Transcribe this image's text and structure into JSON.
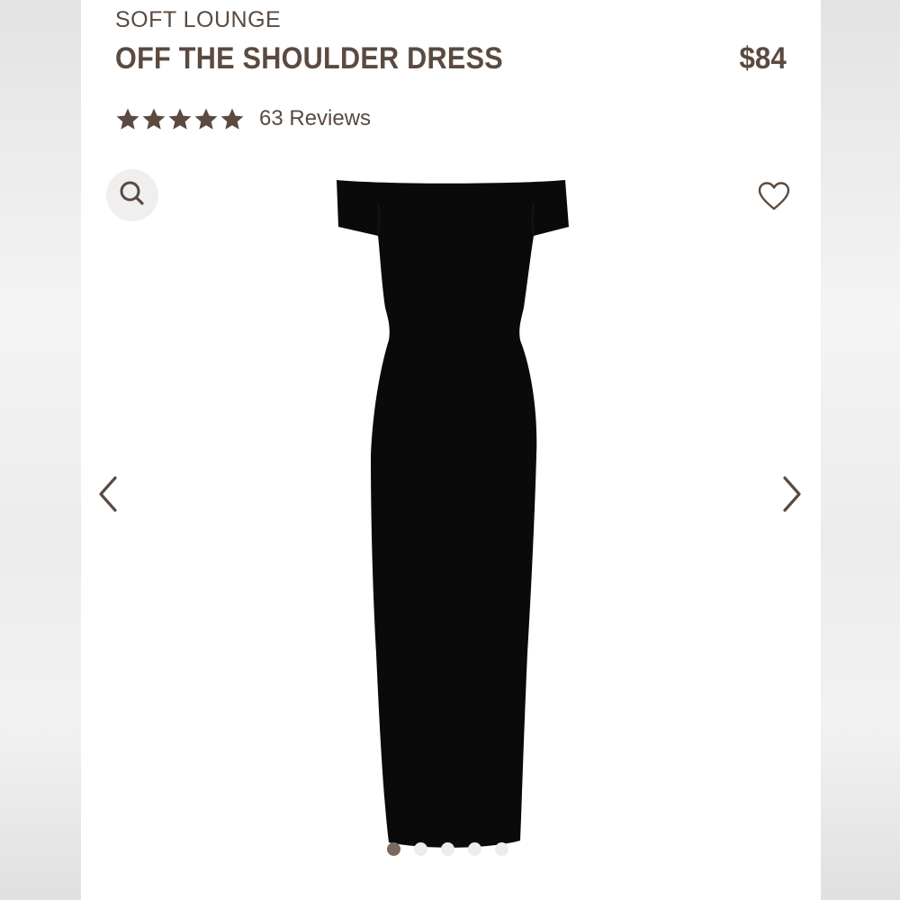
{
  "product": {
    "brand": "SOFT LOUNGE",
    "title": "OFF THE SHOULDER DRESS",
    "price": "$84",
    "rating": {
      "stars": 5,
      "reviews_label": "63 Reviews"
    }
  },
  "controls": {
    "search_icon": "search-icon",
    "wishlist_icon": "heart-icon",
    "prev_icon": "chevron-left-icon",
    "next_icon": "chevron-right-icon"
  },
  "carousel": {
    "total_slides": 5,
    "active_index": 0
  },
  "colors": {
    "text": "#5a4a40",
    "dress": "#0a0a0a",
    "active_dot": "#7a6a5e",
    "inactive_dot": "#ececec"
  }
}
